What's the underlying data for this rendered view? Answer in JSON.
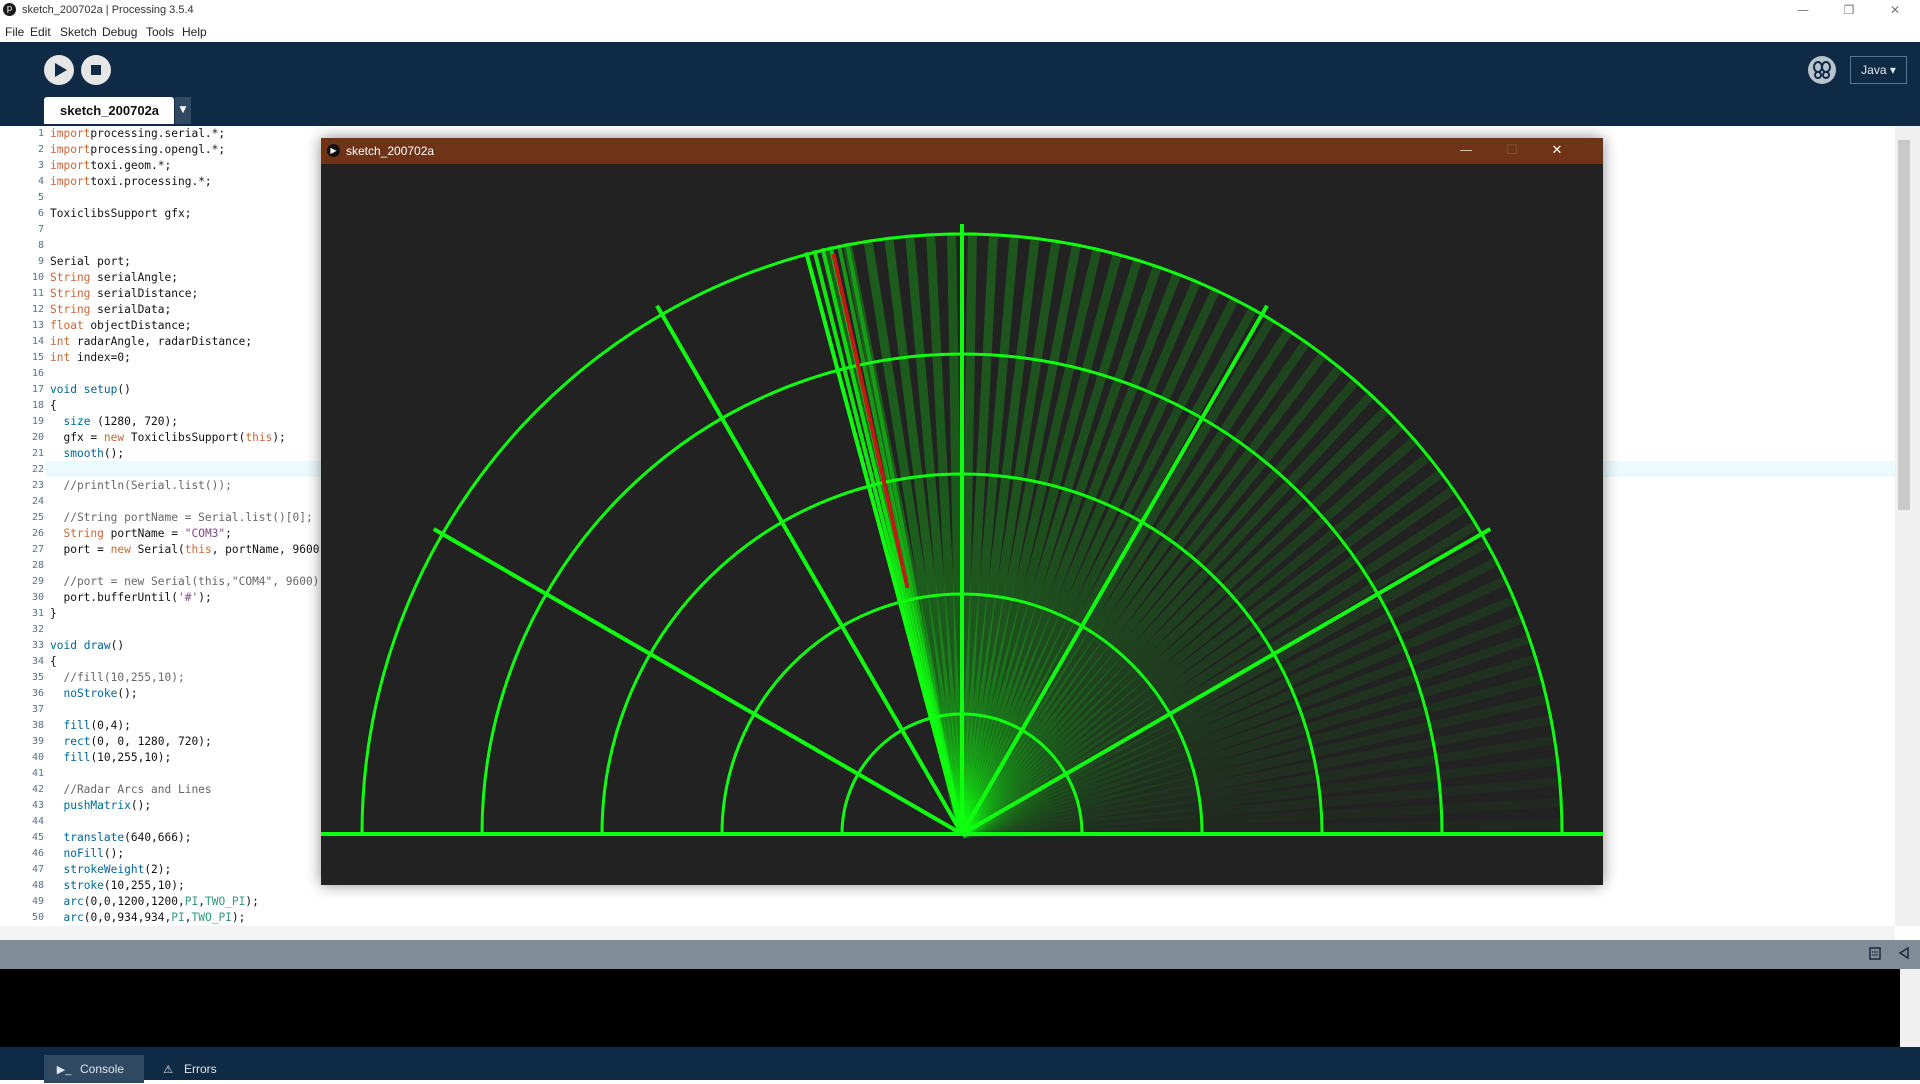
{
  "window": {
    "title": "sketch_200702a | Processing 3.5.4",
    "app_icon": "p",
    "controls": {
      "minimize": "—",
      "restore": "❐",
      "close": "✕"
    }
  },
  "menu": [
    "File",
    "Edit",
    "Sketch",
    "Debug",
    "Tools",
    "Help"
  ],
  "toolbar": {
    "mode": "Java ▾"
  },
  "tabs": [
    {
      "label": "sketch_200702a"
    }
  ],
  "editor": {
    "active_line": 22,
    "lines": [
      {
        "n": "1",
        "tokens": [
          [
            "kw",
            "import"
          ],
          [
            "",
            "processing.serial.*;"
          ]
        ]
      },
      {
        "n": "2",
        "tokens": [
          [
            "kw",
            "import"
          ],
          [
            "",
            "processing.opengl.*;"
          ]
        ]
      },
      {
        "n": "3",
        "tokens": [
          [
            "kw",
            "import"
          ],
          [
            "",
            "toxi.geom.*;"
          ]
        ]
      },
      {
        "n": "4",
        "tokens": [
          [
            "kw",
            "import"
          ],
          [
            "",
            "toxi.processing.*;"
          ]
        ]
      },
      {
        "n": "5",
        "tokens": []
      },
      {
        "n": "6",
        "tokens": [
          [
            "",
            "ToxiclibsSupport gfx;"
          ]
        ]
      },
      {
        "n": "7",
        "tokens": []
      },
      {
        "n": "8",
        "tokens": []
      },
      {
        "n": "9",
        "tokens": [
          [
            "",
            "Serial port;"
          ]
        ]
      },
      {
        "n": "10",
        "tokens": [
          [
            "kw",
            "String"
          ],
          [
            "",
            " serialAngle;"
          ]
        ]
      },
      {
        "n": "11",
        "tokens": [
          [
            "kw",
            "String"
          ],
          [
            "",
            " serialDistance;"
          ]
        ]
      },
      {
        "n": "12",
        "tokens": [
          [
            "kw",
            "String"
          ],
          [
            "",
            " serialData;"
          ]
        ]
      },
      {
        "n": "13",
        "tokens": [
          [
            "kw",
            "float"
          ],
          [
            "",
            " objectDistance;"
          ]
        ]
      },
      {
        "n": "14",
        "tokens": [
          [
            "kw",
            "int"
          ],
          [
            "",
            " radarAngle, radarDistance;"
          ]
        ]
      },
      {
        "n": "15",
        "tokens": [
          [
            "kw",
            "int"
          ],
          [
            "",
            " index=0;"
          ]
        ]
      },
      {
        "n": "16",
        "tokens": []
      },
      {
        "n": "17",
        "tokens": [
          [
            "fn",
            "void"
          ],
          [
            "",
            " "
          ],
          [
            "fn",
            "setup"
          ],
          [
            "",
            "()"
          ]
        ]
      },
      {
        "n": "18",
        "tokens": [
          [
            "",
            "{"
          ]
        ]
      },
      {
        "n": "19",
        "tokens": [
          [
            "",
            "  "
          ],
          [
            "fn",
            "size"
          ],
          [
            "",
            " (1280, 720);"
          ]
        ]
      },
      {
        "n": "20",
        "tokens": [
          [
            "",
            "  gfx = "
          ],
          [
            "kw",
            "new"
          ],
          [
            "",
            " ToxiclibsSupport("
          ],
          [
            "kw",
            "this"
          ],
          [
            "",
            ");"
          ]
        ]
      },
      {
        "n": "21",
        "tokens": [
          [
            "",
            "  "
          ],
          [
            "fn",
            "smooth"
          ],
          [
            "",
            "();"
          ]
        ]
      },
      {
        "n": "22",
        "tokens": []
      },
      {
        "n": "23",
        "tokens": [
          [
            "cm",
            "  //println(Serial.list());"
          ]
        ]
      },
      {
        "n": "24",
        "tokens": []
      },
      {
        "n": "25",
        "tokens": [
          [
            "cm",
            "  //String portName = Serial.list()[0];"
          ]
        ]
      },
      {
        "n": "26",
        "tokens": [
          [
            "",
            "  "
          ],
          [
            "kw",
            "String"
          ],
          [
            "",
            " portName = "
          ],
          [
            "st",
            "\"COM3\""
          ],
          [
            "",
            ";"
          ]
        ]
      },
      {
        "n": "27",
        "tokens": [
          [
            "",
            "  port = "
          ],
          [
            "kw",
            "new"
          ],
          [
            "",
            " Serial("
          ],
          [
            "kw",
            "this"
          ],
          [
            "",
            ", portName, 9600);"
          ]
        ]
      },
      {
        "n": "28",
        "tokens": []
      },
      {
        "n": "29",
        "tokens": [
          [
            "cm",
            "  //port = new Serial(this,\"COM4\", 9600);"
          ]
        ]
      },
      {
        "n": "30",
        "tokens": [
          [
            "",
            "  port.bufferUntil("
          ],
          [
            "st",
            "'#'"
          ],
          [
            "",
            ");"
          ]
        ]
      },
      {
        "n": "31",
        "tokens": [
          [
            "",
            "}"
          ]
        ]
      },
      {
        "n": "32",
        "tokens": []
      },
      {
        "n": "33",
        "tokens": [
          [
            "fn",
            "void"
          ],
          [
            "",
            " "
          ],
          [
            "fn",
            "draw"
          ],
          [
            "",
            "()"
          ]
        ]
      },
      {
        "n": "34",
        "tokens": [
          [
            "",
            "{"
          ]
        ]
      },
      {
        "n": "35",
        "tokens": [
          [
            "cm",
            "  //fill(10,255,10);"
          ]
        ]
      },
      {
        "n": "36",
        "tokens": [
          [
            "",
            "  "
          ],
          [
            "fn",
            "noStroke"
          ],
          [
            "",
            "();"
          ]
        ]
      },
      {
        "n": "37",
        "tokens": []
      },
      {
        "n": "38",
        "tokens": [
          [
            "",
            "  "
          ],
          [
            "fn",
            "fill"
          ],
          [
            "",
            "(0,4);"
          ]
        ]
      },
      {
        "n": "39",
        "tokens": [
          [
            "",
            "  "
          ],
          [
            "fn",
            "rect"
          ],
          [
            "",
            "(0, 0, 1280, 720);"
          ]
        ]
      },
      {
        "n": "40",
        "tokens": [
          [
            "",
            "  "
          ],
          [
            "fn",
            "fill"
          ],
          [
            "",
            "(10,255,10);"
          ]
        ]
      },
      {
        "n": "41",
        "tokens": []
      },
      {
        "n": "42",
        "tokens": [
          [
            "cm",
            "  //Radar Arcs and Lines"
          ]
        ]
      },
      {
        "n": "43",
        "tokens": [
          [
            "",
            "  "
          ],
          [
            "fn",
            "pushMatrix"
          ],
          [
            "",
            "();"
          ]
        ]
      },
      {
        "n": "44",
        "tokens": []
      },
      {
        "n": "45",
        "tokens": [
          [
            "",
            "  "
          ],
          [
            "fn",
            "translate"
          ],
          [
            "",
            "(640,666);"
          ]
        ]
      },
      {
        "n": "46",
        "tokens": [
          [
            "",
            "  "
          ],
          [
            "fn",
            "noFill"
          ],
          [
            "",
            "();"
          ]
        ]
      },
      {
        "n": "47",
        "tokens": [
          [
            "",
            "  "
          ],
          [
            "fn",
            "strokeWeight"
          ],
          [
            "",
            "(2);"
          ]
        ]
      },
      {
        "n": "48",
        "tokens": [
          [
            "",
            "  "
          ],
          [
            "fn",
            "stroke"
          ],
          [
            "",
            "(10,255,10);"
          ]
        ]
      },
      {
        "n": "49",
        "tokens": [
          [
            "",
            "  "
          ],
          [
            "fn",
            "arc"
          ],
          [
            "",
            "(0,0,1200,1200,"
          ],
          [
            "bl",
            "PI"
          ],
          [
            "",
            ","
          ],
          [
            "bl",
            "TWO_PI"
          ],
          [
            "",
            ");"
          ]
        ]
      },
      {
        "n": "50",
        "tokens": [
          [
            "",
            "  "
          ],
          [
            "fn",
            "arc"
          ],
          [
            "",
            "(0,0,934,934,"
          ],
          [
            "bl",
            "PI"
          ],
          [
            "",
            ","
          ],
          [
            "bl",
            "TWO_PI"
          ],
          [
            "",
            ");"
          ]
        ]
      }
    ]
  },
  "sketch_window": {
    "title": "sketch_200702a",
    "controls": {
      "minimize": "—",
      "maximize": "☐",
      "close": "✕"
    },
    "radar": {
      "sweep_angle_deg": 105,
      "object_angle_deg": 104,
      "arcs": 5,
      "spokes_deg": [
        30,
        60,
        90,
        120,
        150
      ],
      "colors": {
        "line": "#10ff10",
        "object": "#c21a14",
        "background": "#222222"
      }
    }
  },
  "footer": {
    "console_label": "Console",
    "errors_label": "Errors"
  }
}
